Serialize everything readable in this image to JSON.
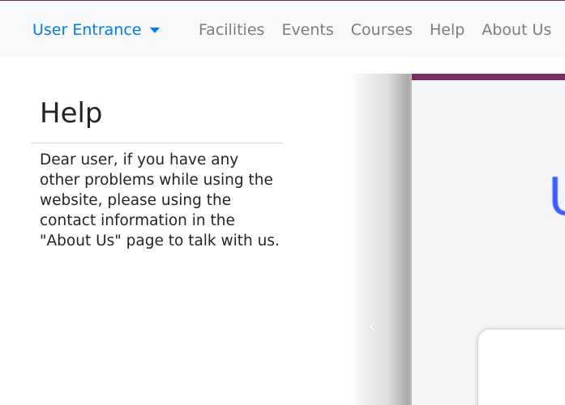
{
  "navbar": {
    "brand_label": "User Entrance",
    "links": [
      "Facilities",
      "Events",
      "Courses",
      "Help",
      "About Us"
    ]
  },
  "help": {
    "title": "Help",
    "body": "Dear user, if you have any other problems while using the website, please using the contact information in the \"About Us\" page to talk with us."
  },
  "carousel": {
    "prev_icon": "chevron-left-icon",
    "visible_glyph": "U"
  },
  "colors": {
    "accent": "#007bff",
    "navbar_bg": "#f8f9fa",
    "nav_link": "#7d7d7d",
    "top_line": "#6f2c5c",
    "slide_bar": "#7a2e66",
    "slide_glyph": "#3d5cff"
  }
}
